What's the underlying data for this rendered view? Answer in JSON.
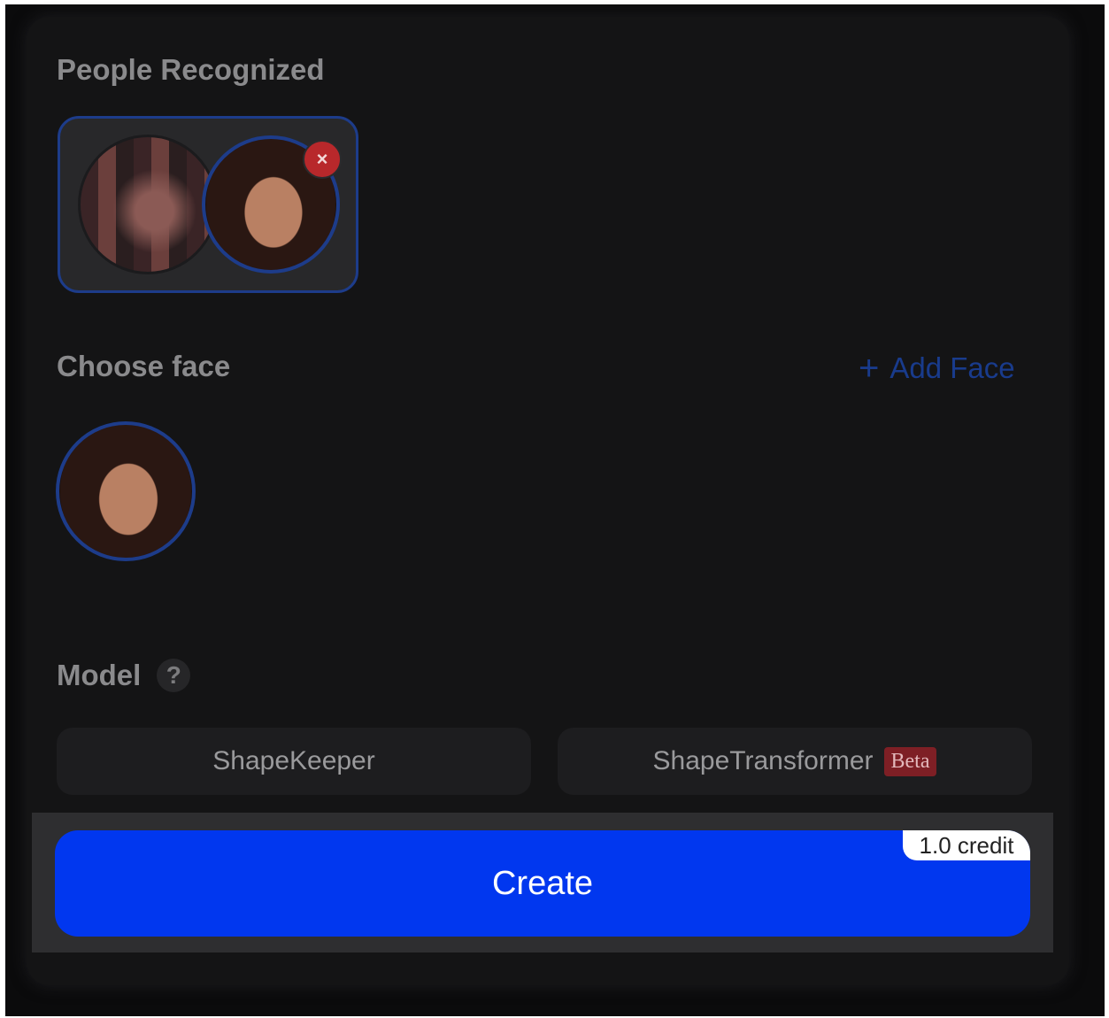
{
  "sections": {
    "people_recognized": "People Recognized",
    "choose_face": "Choose face",
    "model": "Model"
  },
  "add_face": {
    "icon": "plus-icon",
    "plus": "+",
    "label": "Add Face"
  },
  "remove_badge": "×",
  "help_icon": "?",
  "models": [
    {
      "label": "ShapeKeeper"
    },
    {
      "label": "ShapeTransformer",
      "badge": "Beta"
    }
  ],
  "create": {
    "label": "Create",
    "credit": "1.0 credit"
  },
  "colors": {
    "accent_blue": "#0137ef",
    "selected_border": "#1d3c8a",
    "remove_red": "#b8282b",
    "beta_red": "#7e1f25"
  }
}
